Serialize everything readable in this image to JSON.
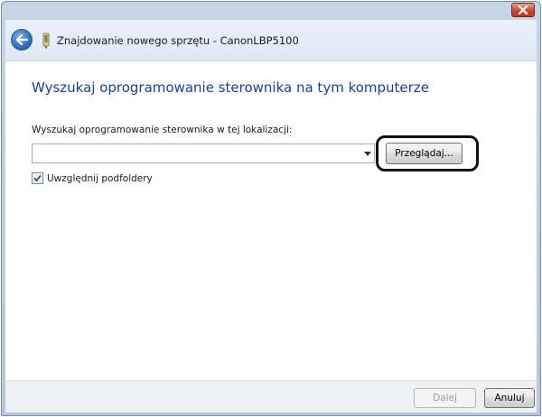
{
  "window": {
    "title": "Znajdowanie nowego sprzętu - CanonLBP5100"
  },
  "page": {
    "heading": "Wyszukaj oprogramowanie sterownika na tym komputerze",
    "location_label": "Wyszukaj oprogramowanie sterownika w tej lokalizacji:",
    "location_value": "",
    "browse_label": "Przeglądaj...",
    "include_subfolders_label": "Uwzględnij podfoldery",
    "include_subfolders_checked": true
  },
  "footer": {
    "next_label": "Dalej",
    "cancel_label": "Anuluj"
  },
  "icons": {
    "close": "close-icon",
    "back": "back-arrow-icon",
    "device": "hardware-device-icon",
    "dropdown": "chevron-down-icon",
    "checkmark": "checkmark-icon"
  },
  "colors": {
    "heading": "#1e3f8a",
    "close_button": "#c74a32",
    "back_button": "#2f6fb6"
  }
}
